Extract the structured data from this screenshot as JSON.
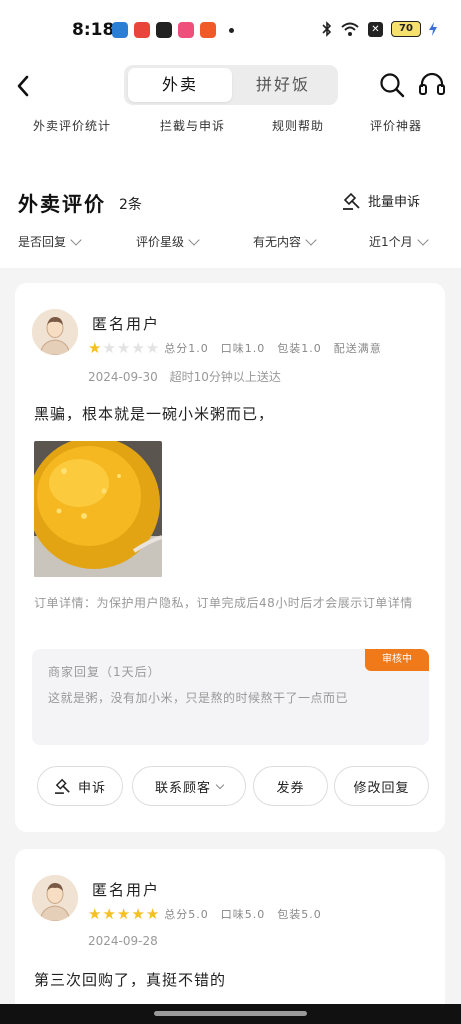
{
  "status": {
    "time": "8:18",
    "battery": "70",
    "notif_icons": [
      {
        "name": "app-icon-1",
        "color": "#2a7fd4"
      },
      {
        "name": "app-icon-2",
        "color": "#e8463c"
      },
      {
        "name": "app-icon-3",
        "color": "#222222"
      },
      {
        "name": "app-icon-4",
        "color": "#f04f7b"
      },
      {
        "name": "app-icon-5",
        "color": "#f05a28"
      }
    ]
  },
  "nav": {
    "tabs": [
      "外卖",
      "拼好饭"
    ],
    "active_tab": "外卖",
    "icons": [
      "back-icon",
      "search-icon",
      "headset-icon"
    ]
  },
  "quick_links": [
    "外卖评价统计",
    "拦截与申诉",
    "规则帮助",
    "评价神器"
  ],
  "section": {
    "title": "外卖评价",
    "count": "2条",
    "batch_appeal": "批量申诉"
  },
  "filters": [
    "是否回复",
    "评价星级",
    "有无内容",
    "近1个月"
  ],
  "reviews": [
    {
      "user": "匿名用户",
      "stars": 1,
      "total": "总分1.0",
      "taste": "口味1.0",
      "packaging": "包装1.0",
      "delivery": "配送满意",
      "date": "2024-09-30",
      "delivery_note": "超时10分钟以上送达",
      "text": "黑骗，根本就是一碗小米粥而已，",
      "order_note": "订单详情：为保护用户隐私，订单完成后48小时后才会展示订单详情",
      "reply_label": "商家回复（1天后）",
      "reply_text": "这就是粥，没有加小米，只是熬的时候熬干了一点而已",
      "reply_status": "审核中",
      "actions": [
        "申诉",
        "联系顾客",
        "发券",
        "修改回复"
      ]
    },
    {
      "user": "匿名用户",
      "stars": 5,
      "total": "总分5.0",
      "taste": "口味5.0",
      "packaging": "包装5.0",
      "date": "2024-09-28",
      "text": "第三次回购了，真挺不错的"
    }
  ],
  "colors": {
    "accent_orange": "#f07a1a",
    "star_gold": "#f5c024",
    "background": "#f4f4f4"
  }
}
